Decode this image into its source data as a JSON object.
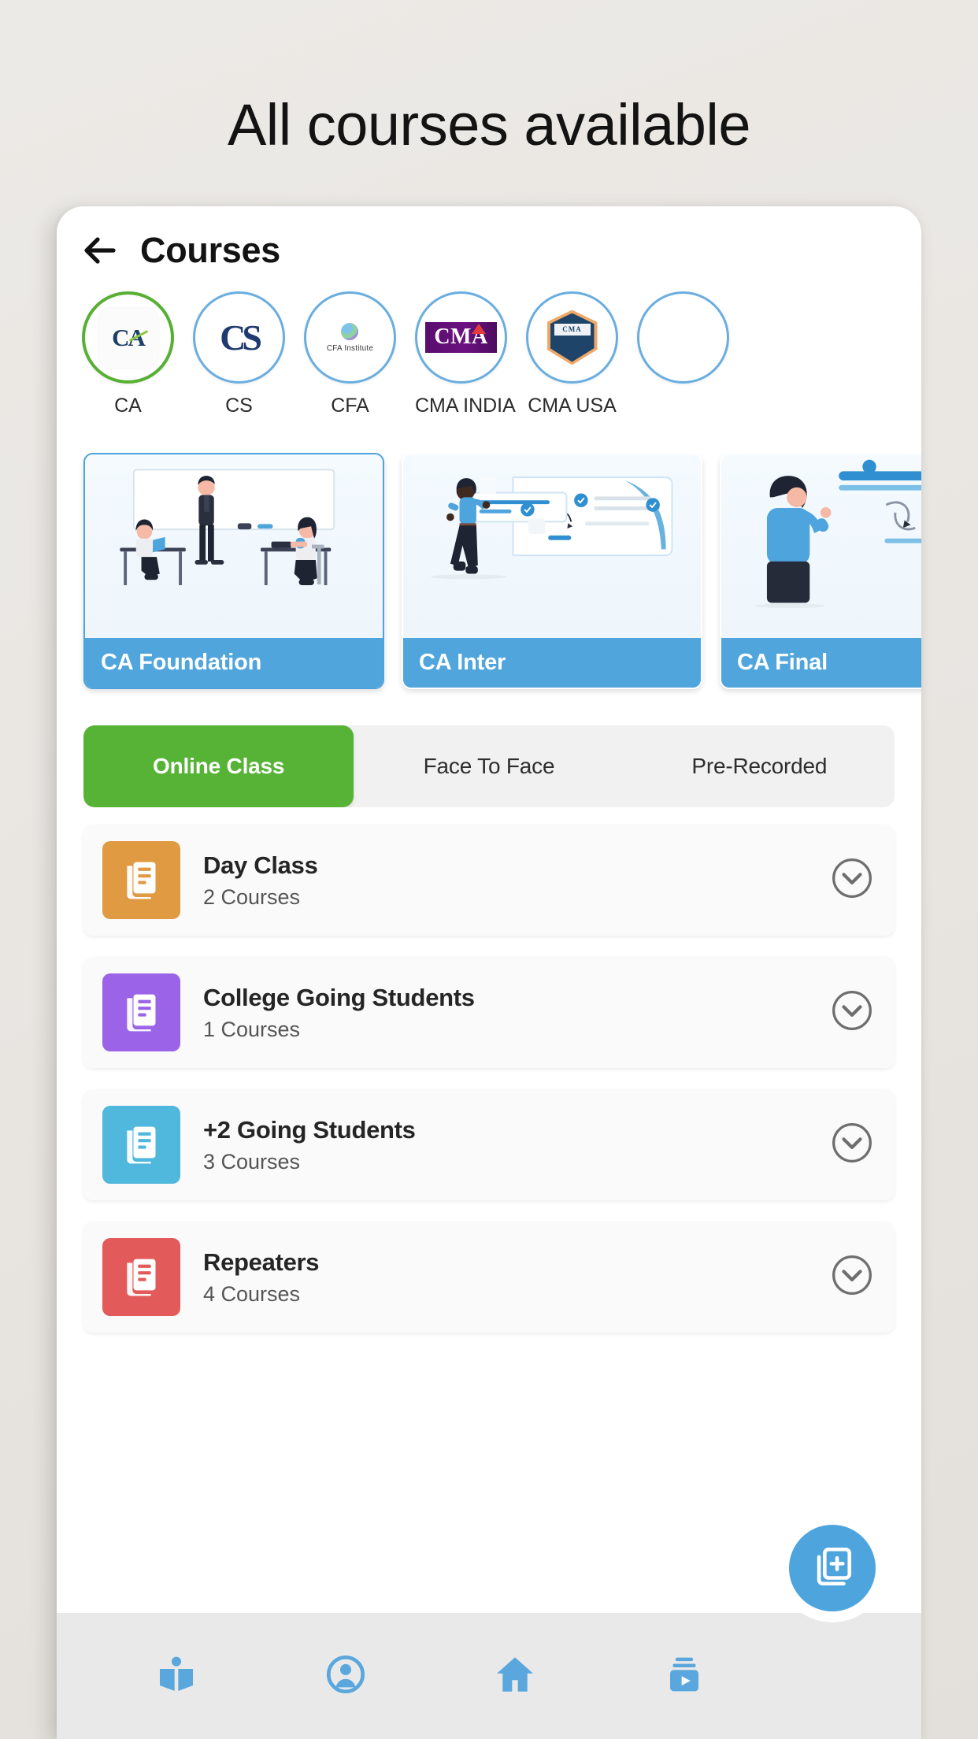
{
  "headline": "All courses available",
  "appbar": {
    "back_icon": "arrow-left-icon",
    "title": "Courses"
  },
  "categories": [
    {
      "label": "CA",
      "logo": "ca-logo",
      "selected": true,
      "accent": "#57b033"
    },
    {
      "label": "CS",
      "logo": "cs-logo",
      "selected": false,
      "accent": "#6aaee0"
    },
    {
      "label": "CFA",
      "logo": "cfa-logo",
      "selected": false,
      "accent": "#6aaee0"
    },
    {
      "label": "CMA INDIA",
      "logo": "cma-india-logo",
      "selected": false,
      "accent": "#6aaee0"
    },
    {
      "label": "CMA USA",
      "logo": "cma-usa-logo",
      "selected": false,
      "accent": "#6aaee0"
    },
    {
      "label": "",
      "logo": "partial-logo",
      "selected": false,
      "accent": "#6aaee0"
    }
  ],
  "category_logo_text": {
    "ca": "CA",
    "cs": "CS",
    "cfa": "CFA Institute",
    "cma_india": "CMA",
    "cma_usa": "CMA"
  },
  "banners": [
    {
      "title": "CA Foundation",
      "art": "classroom-illustration",
      "active": true
    },
    {
      "title": "CA Inter",
      "art": "checklist-illustration",
      "active": false
    },
    {
      "title": "CA Final",
      "art": "whiteboard-illustration",
      "active": false
    }
  ],
  "tabs": [
    {
      "label": "Online Class",
      "active": true
    },
    {
      "label": "Face To Face",
      "active": false
    },
    {
      "label": "Pre-Recorded",
      "active": false
    }
  ],
  "list": [
    {
      "title": "Day Class",
      "subtitle": "2 Courses",
      "color": "#e09a42",
      "icon": "document-stack-icon",
      "chevron": "chevron-down-circle-icon"
    },
    {
      "title": "College Going Students",
      "subtitle": "1 Courses",
      "color": "#9b63e8",
      "icon": "document-stack-icon",
      "chevron": "chevron-down-circle-icon"
    },
    {
      "title": "+2 Going Students",
      "subtitle": "3 Courses",
      "color": "#51b8dd",
      "icon": "document-stack-icon",
      "chevron": "chevron-down-circle-icon"
    },
    {
      "title": "Repeaters",
      "subtitle": "4 Courses",
      "color": "#e25a59",
      "icon": "document-stack-icon",
      "chevron": "chevron-down-circle-icon"
    }
  ],
  "fab": {
    "icon": "add-document-icon",
    "color": "#4ea4dd"
  },
  "bottom_nav": [
    {
      "icon": "open-book-icon"
    },
    {
      "icon": "person-circle-icon"
    },
    {
      "icon": "home-icon"
    },
    {
      "icon": "video-playlist-icon"
    }
  ],
  "colors": {
    "background": "#eceae6",
    "accent_blue": "#4ea4dd",
    "accent_green": "#56b335",
    "banner_bar": "#50a5dc",
    "nav_icon": "#5aa7de"
  }
}
